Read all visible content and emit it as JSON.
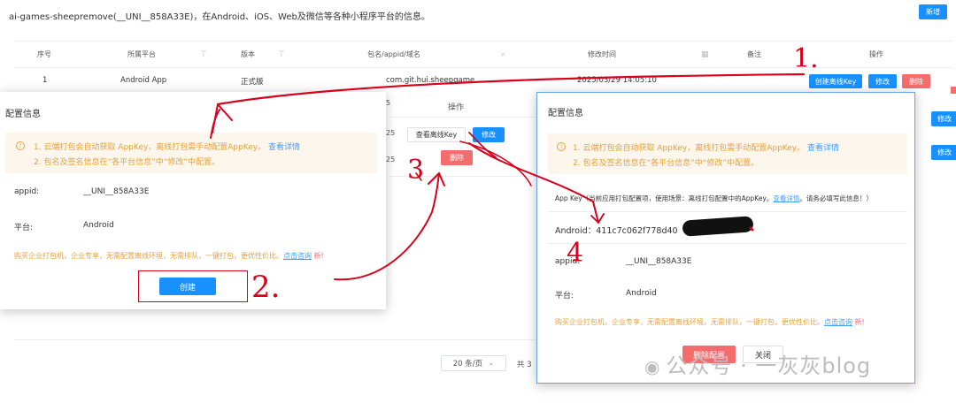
{
  "page": {
    "header_text": "ai-games-sheepremove(__UNI__858A33E)，在Android、iOS、Web及微信等各种小程序平台的信息。",
    "new_button": "新增"
  },
  "table": {
    "headers": [
      "序号",
      "所属平台",
      "版本",
      "包名/appid/域名",
      "修改时间",
      "备注",
      "操作"
    ],
    "row": {
      "index": "1",
      "platform": "Android App",
      "version": "正式版",
      "package": "com.git.hui.sheepgame",
      "time": "2025/03/29 14:05:10",
      "btn_create_offline": "创建离线Key",
      "btn_edit": "修改",
      "btn_delete": "删除"
    },
    "ops_header": "操作",
    "btn_view_offline": "查看离线Key",
    "btn_edit": "修改",
    "btn_delete": "删除",
    "right_btn_edit": "修改"
  },
  "pagination": {
    "page_size": "20 条/页",
    "total_prefix": "共 3"
  },
  "dialog_left": {
    "title": "配置信息",
    "notice_1": "1. 云端打包会自动获取 AppKey，离线打包需手动配置AppKey。",
    "notice_1_link": "查看详情",
    "notice_2": "2. 包名及签名信息在“各平台信息”中“修改”中配置。",
    "appid_label": "appid:",
    "appid_value": "__UNI__858A33E",
    "platform_label": "平台:",
    "platform_value": "Android",
    "promo_text": "购买企业打包机，企业专享，无需配置离线环境，无需排队，一键打包，更优性价比。",
    "promo_link": "点击咨询",
    "promo_new": "新!",
    "create_button": "创建"
  },
  "dialog_right": {
    "title": "配置信息",
    "notice_1": "1. 云端打包会自动获取 AppKey，离线打包需手动配置AppKey。",
    "notice_1_link": "查看详情",
    "notice_2": "2. 包名及签名信息在“各平台信息”中“修改”中配置。",
    "appkey_note": "App Key（当前应用打包配置项，使用场景：离线打包配置中的AppKey。",
    "appkey_note_link": "查看详情",
    "appkey_note_tail": "。请务必填写此信息！）",
    "android_key": "Android：411c7c062f778d40",
    "appid_label": "appid:",
    "appid_value": "__UNI__858A33E",
    "platform_label": "平台:",
    "platform_value": "Android",
    "promo_text": "购买企业打包机，企业专享，无需配置离线环境，无需排队，一键打包，更优性价比。",
    "promo_link": "点击咨询",
    "promo_new": "新!",
    "delete_config_button": "删除配置",
    "close_button": "关闭"
  },
  "annotations": {
    "n1": "1.",
    "n2": "2.",
    "n3": "3",
    "n4": "4"
  },
  "watermark": {
    "text": "公众号 · 一灰灰blog"
  },
  "colors": {
    "primary": "#1890ff",
    "danger": "#f56c6c",
    "warning": "#e6a23c",
    "annotation": "#d9001b"
  }
}
